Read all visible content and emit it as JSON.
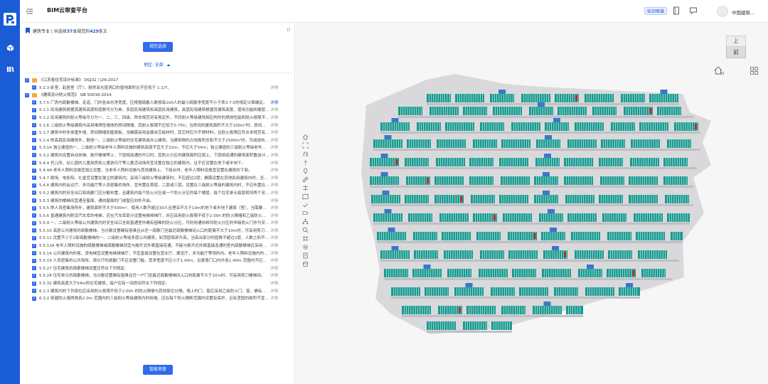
{
  "app": {
    "title": "BIM云审查平台",
    "user_name": "中国建筑..."
  },
  "header": {
    "knowledge_graph": "知识图谱"
  },
  "colors": {
    "primary": "#1a5bd6",
    "button": "#2f6bea",
    "folder": "#f2a93b",
    "model_room": "#199b90",
    "model_core": "#3a78c8",
    "model_alert": "#c4242a"
  },
  "icons": {
    "rail": [
      "logo-icon",
      "cube-icon",
      "book-icon"
    ],
    "topbar": [
      "menu-toggle-icon",
      "notebook-icon",
      "message-icon"
    ]
  },
  "summary": {
    "prefix": "建筑专业 | 共选择",
    "count1": "37",
    "mid": "本规范的",
    "count2": "429",
    "suffix": "条文",
    "right": "D"
  },
  "spec_button": "规范选择",
  "region_label": "地区: 全部",
  "submit_button": "智能审查",
  "viewcube": {
    "top": "上",
    "front": "前"
  },
  "rules": [
    {
      "group": true,
      "text": "《江苏省住宅设计标准》 DGJ32 / J26-2017",
      "action": ""
    },
    {
      "group": false,
      "text": "5.2.3 卧室、起居室（厅）、厨房采光窗洞口的窗地面积比不应低于 1.1/7。",
      "action": "详情"
    },
    {
      "group": true,
      "text": "《建筑设计防火规范》 GB 50016-2014",
      "action": ""
    },
    {
      "group": false,
      "text": "3.7.5 厂房内疏散楼梯、走道、门的各自总净宽度，应根据疏散人数按每100人的最小疏散净宽度不小于表3.7.5的规定计算确定。",
      "action": "详情",
      "active": true
    },
    {
      "group": false,
      "text": "5.1.1 民用建筑根据其建筑高度和层数可分为单、多层民用建筑和高层民用建筑。高层民用建筑根据其建筑高度、使用功能和楼层的建筑面积可分为一类和二类。",
      "action": "详情"
    },
    {
      "group": false,
      "text": "5.1.2 民用建筑的耐火等级可分为一、二、三、四级。除本规范另有规定外，不同耐火等级建筑相应构件的燃烧性能和耐火极限不应低于表5.1.2的规定。",
      "action": "详情"
    },
    {
      "group": false,
      "text": "5.1.6 二级耐火等级建筑内采用难燃性墙体的房间隔墙，其耐火极限不应低于0.75h；当房间的建筑面积不大于100m²时，房间隔墙可采用耐火极限不低于0.50h的难燃性墙体。",
      "action": "详情"
    },
    {
      "group": false,
      "text": "5.1.7 建筑中的非承重外墙、房间隔墙和屋面板，当确需采用金属夹芯板材时，其芯材应为不燃材料，且耐火极限应符合本规范有关规定。",
      "action": "详情"
    },
    {
      "group": false,
      "text": "5.2.4 除高层民用建筑外，数座一、二级耐火等级的住宅建筑或办公建筑，当建筑物的占地面积总和不大于2500m²时，可成组布置。",
      "action": "详情"
    },
    {
      "group": false,
      "text": "5.3.1A 独立建造的一、二级耐火等级老年人照料设施的建筑高度不宜大于32m，不应大于54m；独立建造的三级耐火等级老年人照料设施，不应超过2层。",
      "action": "详情"
    },
    {
      "group": false,
      "text": "5.3.2 建筑内设置自动扶梯、敞开楼梯等上、下层相连通的开口时，其防火分区的建筑面积应按上、下层相连通的建筑面积叠加计算。",
      "action": "详情"
    },
    {
      "group": false,
      "text": "5.4.4 托儿所、幼儿园的儿童用房和儿童游乐厅等儿童活动场所宜设置在独立的建筑内，且不应设置在地下或半地下。",
      "action": "详情"
    },
    {
      "group": false,
      "text": "5.4.4A 老年人照料设施宜独立设置。当老年人照料设施与其他建筑上、下组合时，老年人照料设施宜设置在建筑的下部。",
      "action": "详情"
    },
    {
      "group": false,
      "text": "5.4.7 剧场、电影院、礼堂宜设置在独立的建筑内；采用三级耐火等级建筑时，不应超过2层；确需设置在其他民用建筑内时，至少应设置1个独立的安全出口和疏散楼梯。",
      "action": "详情"
    },
    {
      "group": false,
      "text": "5.4.8 建筑内的会议厅、多功能厅等人员密集的场所，宜布置在首层、二层或三层。设置在三级耐火等级的建筑内时，不应布置在三层及以上楼层。",
      "action": "详情"
    },
    {
      "group": false,
      "text": "5.5.2 建筑内的安全出口和疏散门应分散布置，且建筑内每个防火分区或一个防火分区的每个楼层、每个住宅单元每层相邻两个安全出口的水平距离不应小于5m。",
      "action": "详情"
    },
    {
      "group": false,
      "text": "5.5.3 建筑的楼梯间宜通至屋面，通向屋面的门或窗应向外开启。",
      "action": "详情"
    },
    {
      "group": false,
      "text": "5.5.5 除人员密集场所外，建筑面积不大于500m²、使用人数不超过30人且埋深不大于10m的地下或半地下建筑（室），当需要设置2个安全出口时，其中一个安全出口可利用直通室外的金属竖向梯。",
      "action": "详情"
    },
    {
      "group": false,
      "text": "5.5.6 直通建筑内附设汽车库的电梯，应在汽车库部分设置电梯候梯厅，并应采用耐火极限不低于2.00h 的防火隔墙和乙级防火门与汽车库分隔。",
      "action": "详情"
    },
    {
      "group": false,
      "text": "5.5.9 一、二级耐火等级公共建筑内的安全出口全部直通室外确有困难的防火分区，可利用通向相邻防火分区的甲级防火门作为安全出口。",
      "action": "详情"
    },
    {
      "group": false,
      "text": "5.5.10 高层公共建筑的疏散楼梯，当分散设置确有困难且从任一疏散门至最近疏散楼梯间入口的距离不大于10m时，可采用剪刀楼梯间。",
      "action": "详情"
    },
    {
      "group": false,
      "text": "5.5.11 设置不少于2部疏散楼梯的一、二级耐火等级多层公共建筑，如顶层局部升高，当高出部分的层数不超过2层、人数之和不超过50人且每层建筑面积不大于200m²时，高出部分可设置一部疏散楼梯。",
      "action": "详情"
    },
    {
      "group": false,
      "text": "5.5.13A 老年人照料设施的疏散楼梯或疏散楼梯间宜与敞开式外廊直接连通，不能与敞开式外廊直接连通的室内疏散楼梯应采用封闭楼梯间。",
      "action": "详情"
    },
    {
      "group": false,
      "text": "5.5.14 公共建筑内的客、货电梯宜设置电梯候梯厅，不宜直接设置在营业厅、展览厅、多功能厅等场所内。老年人照料设施内的非消防电梯应采取防烟措施。",
      "action": "详情"
    },
    {
      "group": false,
      "text": "5.5.19 人员密集的公共场所、观众厅的疏散门不应设置门槛，其净宽度不应小于1.40m，且紧靠门口内外各1.40m 范围内不应设置踏步。",
      "action": "详情"
    },
    {
      "group": false,
      "text": "5.5.27 住宅建筑的疏散楼梯设置应符合下列规定:",
      "action": "详情"
    },
    {
      "group": false,
      "text": "5.5.28 住宅单元的疏散楼梯，当分散设置确有困难且任一户门至最近疏散楼梯间入口的距离不大于10m时，可采用剪刀楼梯间。",
      "action": "详情"
    },
    {
      "group": false,
      "text": "5.5.32 建筑高度大于54m的住宅建筑，每户应有一间房间符合下列规定:",
      "action": "详情"
    },
    {
      "group": false,
      "text": "6.2.3 建筑内的下列部位应采用耐火极限不低于2.00h 的防火隔墙与其他部位分隔，墙上的门、窗应采用乙级防火门、窗，确有困难时，可采用防火卷帘。",
      "action": "详情"
    },
    {
      "group": false,
      "text": "6.3.2 穿越防火墙两侧各2.0m 范围内的三级耐火等级建筑内的砖墙，应在每个防火隔断范围内设置有保护，且有坚固的面积不宜大于...",
      "action": "详情"
    }
  ]
}
